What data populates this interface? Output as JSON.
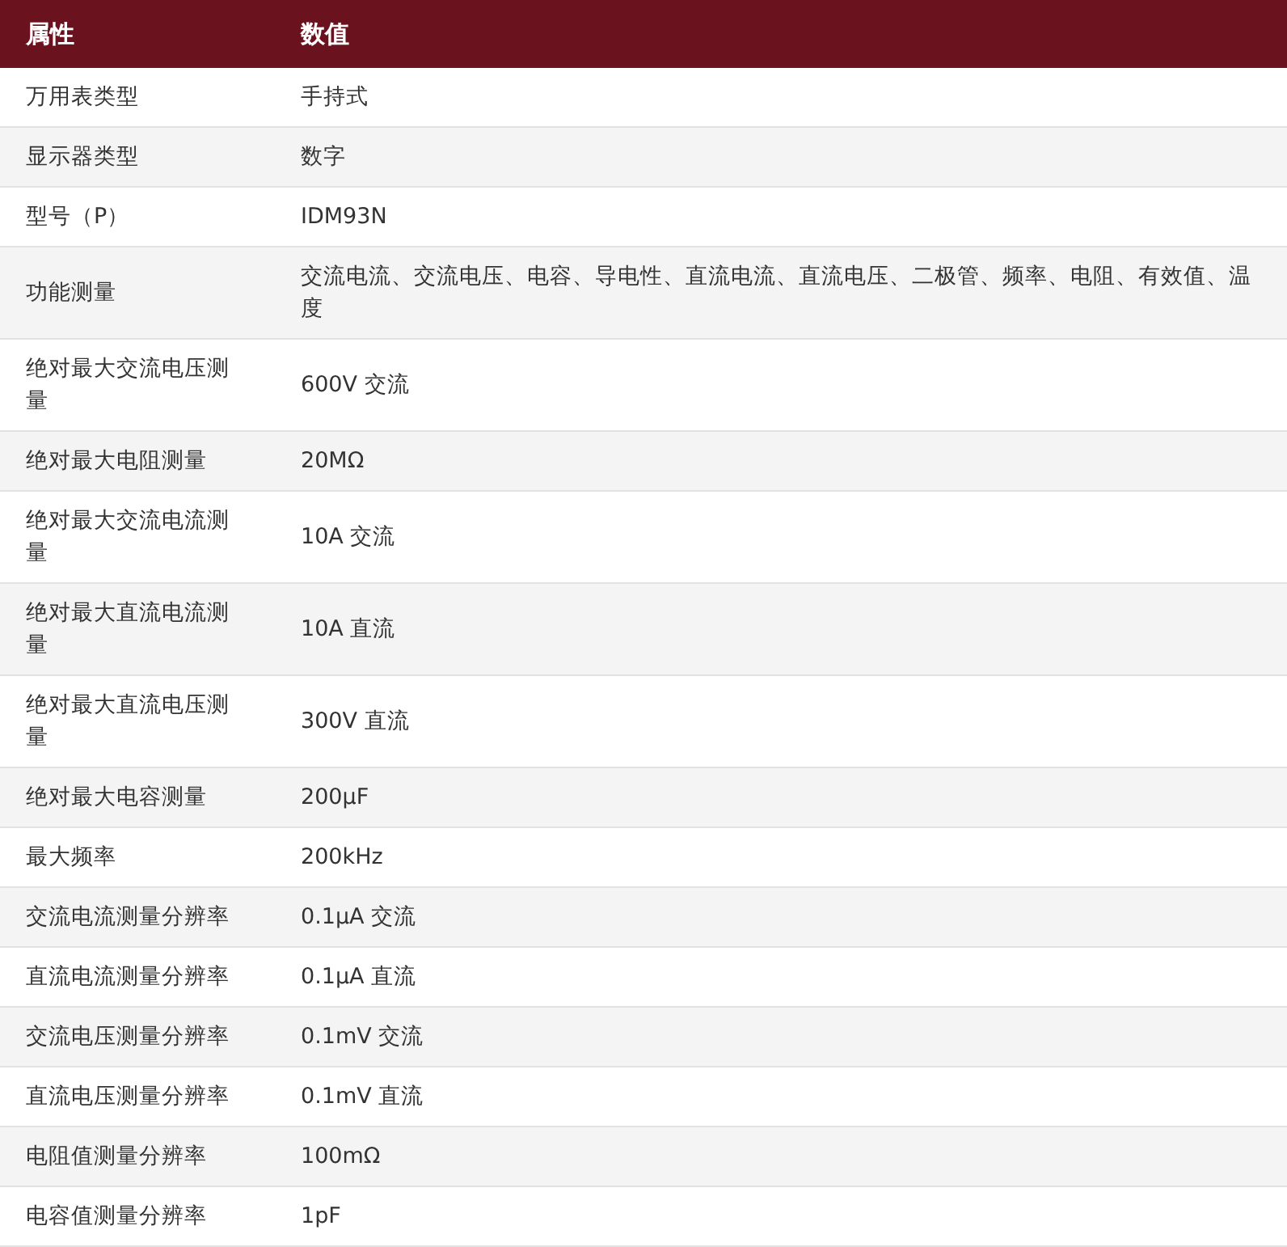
{
  "table": {
    "columns": [
      "属性",
      "数值"
    ],
    "rows": [
      [
        "万用表类型",
        "手持式"
      ],
      [
        "显示器类型",
        "数字"
      ],
      [
        "型号（P）",
        "IDM93N"
      ],
      [
        "功能测量",
        "交流电流、交流电压、电容、导电性、直流电流、直流电压、二极管、频率、电阻、有效值、温度"
      ],
      [
        "绝对最大交流电压测量",
        "600V 交流"
      ],
      [
        "绝对最大电阻测量",
        "20MΩ"
      ],
      [
        "绝对最大交流电流测量",
        "10A 交流"
      ],
      [
        "绝对最大直流电流测量",
        "10A 直流"
      ],
      [
        "绝对最大直流电压测量",
        "300V 直流"
      ],
      [
        "绝对最大电容测量",
        "200µF"
      ],
      [
        "最大频率",
        "200kHz"
      ],
      [
        "交流电流测量分辨率",
        "0.1µA 交流"
      ],
      [
        "直流电流测量分辨率",
        "0.1µA 直流"
      ],
      [
        "交流电压测量分辨率",
        "0.1mV 交流"
      ],
      [
        "直流电压测量分辨率",
        "0.1mV 直流"
      ],
      [
        "电阻值测量分辨率",
        "100mΩ"
      ],
      [
        "电容值测量分辨率",
        "1pF"
      ]
    ]
  }
}
